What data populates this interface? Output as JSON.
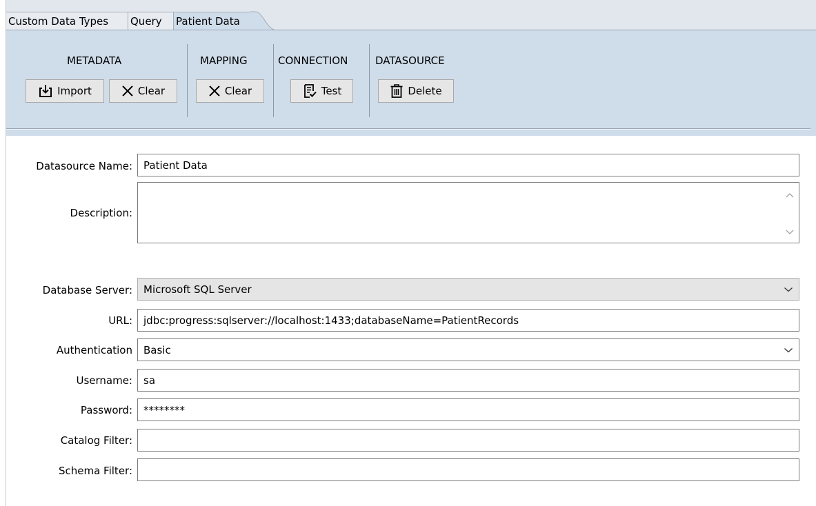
{
  "tabs": [
    {
      "label": "Custom Data Types",
      "active": false
    },
    {
      "label": "Query",
      "active": false
    },
    {
      "label": "Patient Data",
      "active": true
    }
  ],
  "ribbon": {
    "groups": {
      "metadata": {
        "title": "METADATA",
        "import_label": "Import",
        "clear_label": "Clear"
      },
      "mapping": {
        "title": "MAPPING",
        "clear_label": "Clear"
      },
      "connection": {
        "title": "CONNECTION",
        "test_label": "Test"
      },
      "datasource": {
        "title": "DATASOURCE",
        "delete_label": "Delete"
      }
    }
  },
  "form": {
    "datasource_name": {
      "label": "Datasource Name:",
      "value": "Patient Data"
    },
    "description": {
      "label": "Description:",
      "value": ""
    },
    "database_server": {
      "label": "Database Server:",
      "value": "Microsoft SQL Server"
    },
    "url": {
      "label": "URL:",
      "value": "jdbc:progress:sqlserver://localhost:1433;databaseName=PatientRecords"
    },
    "authentication": {
      "label": "Authentication",
      "value": "Basic"
    },
    "username": {
      "label": "Username:",
      "value": "sa"
    },
    "password": {
      "label": "Password:",
      "value": "********"
    },
    "catalog_filter": {
      "label": "Catalog Filter:",
      "value": ""
    },
    "schema_filter": {
      "label": "Schema Filter:",
      "value": ""
    }
  },
  "colors": {
    "ribbon_bg": "#cfdcea",
    "tabstrip_bg": "#e2e7ee",
    "button_bg": "#e6e6e6",
    "disabled_select_bg": "#e5e5e5"
  }
}
